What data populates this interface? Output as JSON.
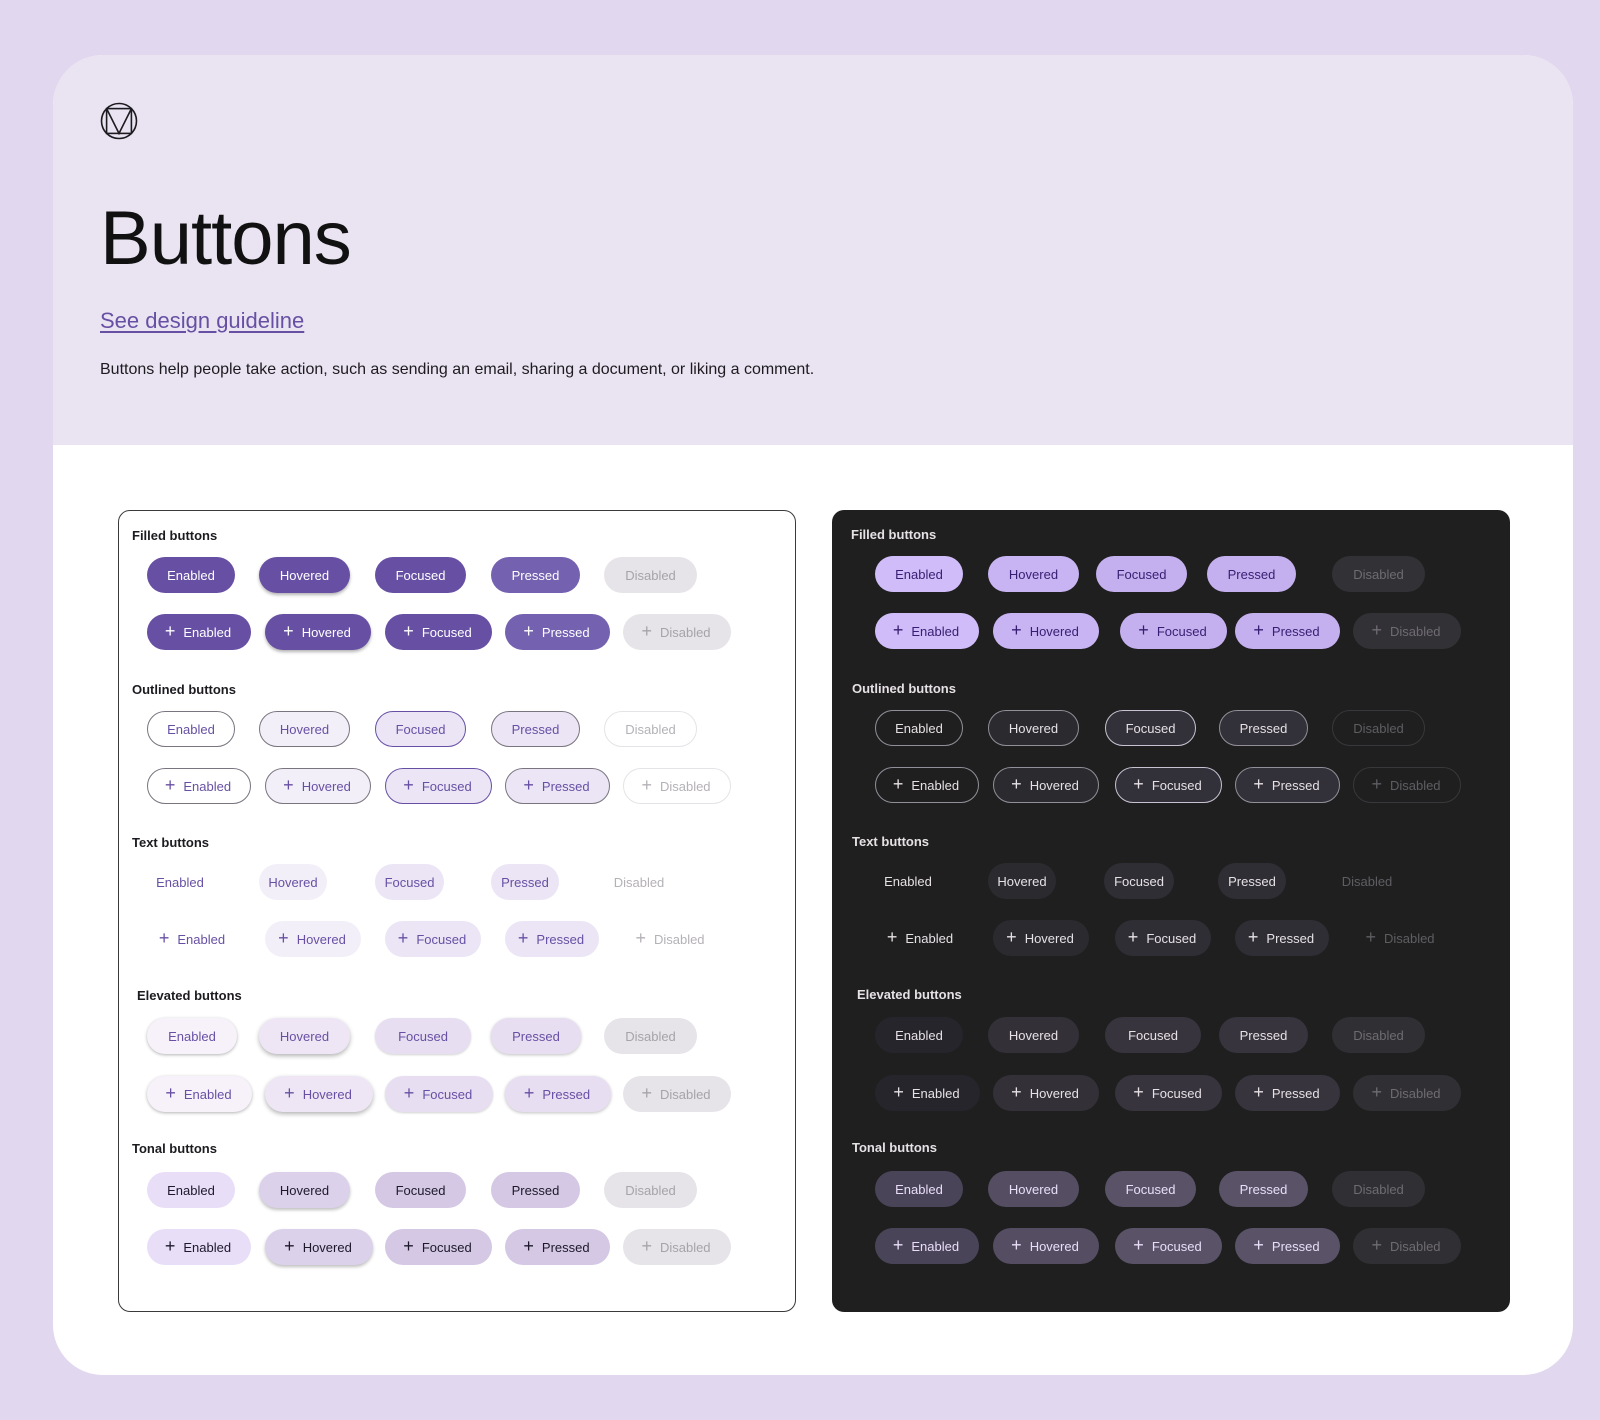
{
  "page": {
    "title": "Buttons",
    "guideline_link": "See design guideline",
    "description": "Buttons help people take action, such as sending an email, sharing a document, or liking a comment.",
    "logo_icon": "material-logo-icon"
  },
  "sections": [
    {
      "key": "filled",
      "label": "Filled buttons"
    },
    {
      "key": "outlined",
      "label": "Outlined buttons"
    },
    {
      "key": "text",
      "label": "Text buttons"
    },
    {
      "key": "elevated",
      "label": "Elevated buttons"
    },
    {
      "key": "tonal",
      "label": "Tonal buttons"
    }
  ],
  "states": [
    "Enabled",
    "Hovered",
    "Focused",
    "Pressed",
    "Disabled"
  ],
  "icon_glyph": "+",
  "icon_name": "add-icon",
  "themes": [
    {
      "key": "light",
      "background": "#ffffff",
      "accent": "#6750a4"
    },
    {
      "key": "dark",
      "background": "#1f1f1f",
      "accent": "#cfbcf8"
    }
  ]
}
